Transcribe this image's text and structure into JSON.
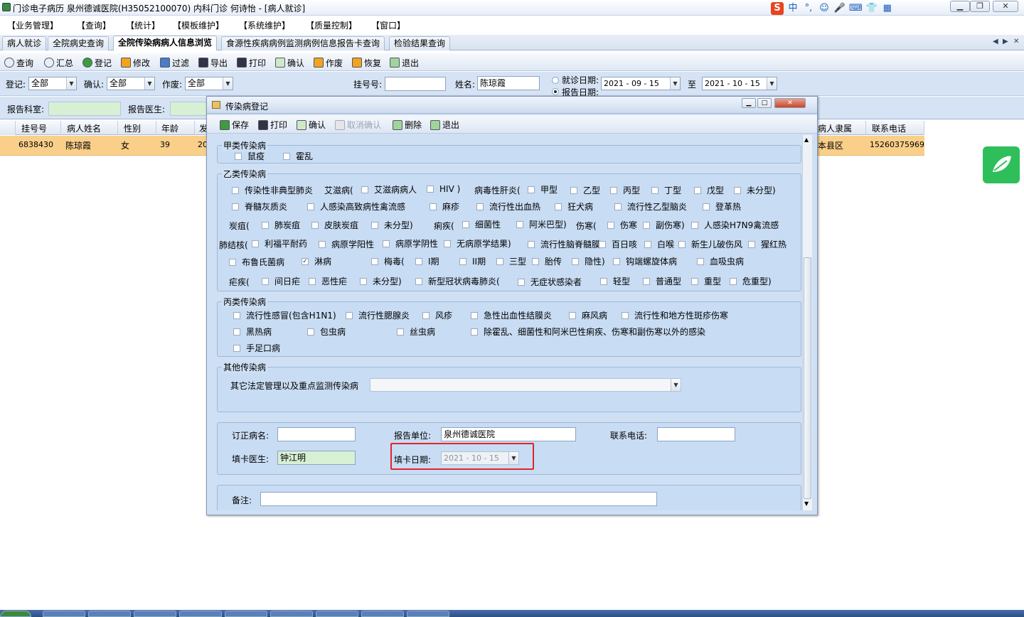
{
  "window": {
    "title": "门诊电子病历  泉州德诚医院(H35052100070)  内科门诊  何诗怡 - [病人就诊]"
  },
  "ime": [
    "S",
    "中",
    "°,",
    "☺",
    "🎤",
    "⌨",
    "👕",
    "▦"
  ],
  "menu": [
    "【业务管理】",
    "【查询】",
    "【统计】",
    "【模板维护】",
    "【系统维护】",
    "【质量控制】",
    "【窗口】"
  ],
  "tabs": [
    "病人就诊",
    "全院病史查询",
    "全院传染病病人信息浏览",
    "食源性疾病病例监测病例信息报告卡查询",
    "检验结果查询"
  ],
  "toolbar": [
    "查询",
    "汇总",
    "登记",
    "修改",
    "过滤",
    "导出",
    "打印",
    "确认",
    "作废",
    "恢复",
    "退出"
  ],
  "filter": {
    "register_label": "登记:",
    "register_value": "全部",
    "confirm_label": "确认:",
    "confirm_value": "全部",
    "void_label": "作废:",
    "void_value": "全部",
    "regno_label": "挂号号:",
    "regno_value": "",
    "name_label": "姓名:",
    "name_value": "陈琼霞",
    "visit_date_label": "就诊日期:",
    "report_date_label": "报告日期:",
    "date_from": "2021 - 09 - 15",
    "to_label": "至",
    "date_to": "2021 - 10 - 15",
    "dept_label": "报告科室:",
    "doctor_label": "报告医生:"
  },
  "grid": {
    "headers": [
      "挂号号",
      "病人姓名",
      "性别",
      "年龄",
      "发",
      "病人隶属",
      "联系电话"
    ],
    "row": [
      "6838430",
      "陈琼霞",
      "女",
      "39",
      "20",
      "本县区",
      "15260375969"
    ]
  },
  "dialog": {
    "title": "传染病登记",
    "toolbar": [
      {
        "label": "保存",
        "enabled": true
      },
      {
        "label": "打印",
        "enabled": true
      },
      {
        "label": "确认",
        "enabled": true
      },
      {
        "label": "取消确认",
        "enabled": false
      },
      {
        "label": "删除",
        "enabled": true
      },
      {
        "label": "退出",
        "enabled": true
      }
    ],
    "group_a": {
      "title": "甲类传染病",
      "items": [
        "鼠疫",
        "霍乱"
      ]
    },
    "group_b": {
      "title": "乙类传染病",
      "r1": {
        "sars": "传染性非典型肺炎",
        "aids": "艾滋病(",
        "aids_patient": "艾滋病病人",
        "hiv": "HIV )",
        "hep": "病毒性肝炎(",
        "hepA": "甲型",
        "hepB": "乙型",
        "hepC": "丙型",
        "hepD": "丁型",
        "hepE": "戊型",
        "hepU": "未分型)"
      },
      "r2": [
        "脊髓灰质炎",
        "人感染高致病性禽流感",
        "麻疹",
        "流行性出血热",
        "狂犬病",
        "流行性乙型脑炎",
        "登革热"
      ],
      "r3": {
        "anthrax": "炭疽(",
        "lung": "肺炭疽",
        "skin": "皮肤炭疽",
        "untyped": "未分型)",
        "dys": "痢疾(",
        "bac": "细菌性",
        "amoeba": "阿米巴型)",
        "typhoid": "伤寒(",
        "typhoid1": "伤寒",
        "paratyphoid": "副伤寒)",
        "h7n9": "人感染H7N9禽流感"
      },
      "r4": {
        "tb": "肺结核(",
        "rif": "利福平耐药",
        "pos": "病原学阳性",
        "neg": "病原学阴性",
        "none": "无病原学结果)",
        "mening": "流行性脑脊髓膜",
        "pertussis": "百日咳",
        "diph": "白喉",
        "tetanus": "新生儿破伤风",
        "scarlet": "猩红热"
      },
      "r5": {
        "bru": "布鲁氏菌病",
        "gon": "淋病",
        "syph": "梅毒(",
        "s1": "I期",
        "s2": "II期",
        "s3": "三型",
        "s4": "胎传",
        "s5": "隐性)",
        "lep": "钩端螺旋体病",
        "sch": "血吸虫病"
      },
      "r6": {
        "mal": "疟疾(",
        "viv": "间日疟",
        "fal": "恶性疟",
        "mu": "未分型)",
        "cov": "新型冠状病毒肺炎(",
        "asym": "无症状感染者",
        "mild": "轻型",
        "norm": "普通型",
        "sev": "重型",
        "crit": "危重型)"
      }
    },
    "group_c": {
      "title": "丙类传染病",
      "items": [
        "流行性感冒(包含H1N1)",
        "流行性腮腺炎",
        "风疹",
        "急性出血性结膜炎",
        "麻风病",
        "流行性和地方性斑疹伤寒",
        "黑热病",
        "包虫病",
        "丝虫病",
        "除霍乱、细菌性和阿米巴性痢疾、伤寒和副伤寒以外的感染",
        "手足口病"
      ]
    },
    "group_other": {
      "title": "其他传染病",
      "label": "其它法定管理以及重点监测传染病",
      "value": ""
    },
    "info": {
      "revised_label": "订正病名:",
      "revised_value": "",
      "unit_label": "报告单位:",
      "unit_value": "泉州德诚医院",
      "phone_label": "联系电话:",
      "phone_value": "",
      "doctor_label": "填卡医生:",
      "doctor_value": "钟江明",
      "date_label": "填卡日期:",
      "date_value": "2021 - 10 - 15"
    },
    "remark_label": "备注:",
    "remark_value": ""
  },
  "colors": {
    "accent_row": "#f9cf8a",
    "panel": "#cfe0f4",
    "highlight_box": "#e0262a"
  }
}
